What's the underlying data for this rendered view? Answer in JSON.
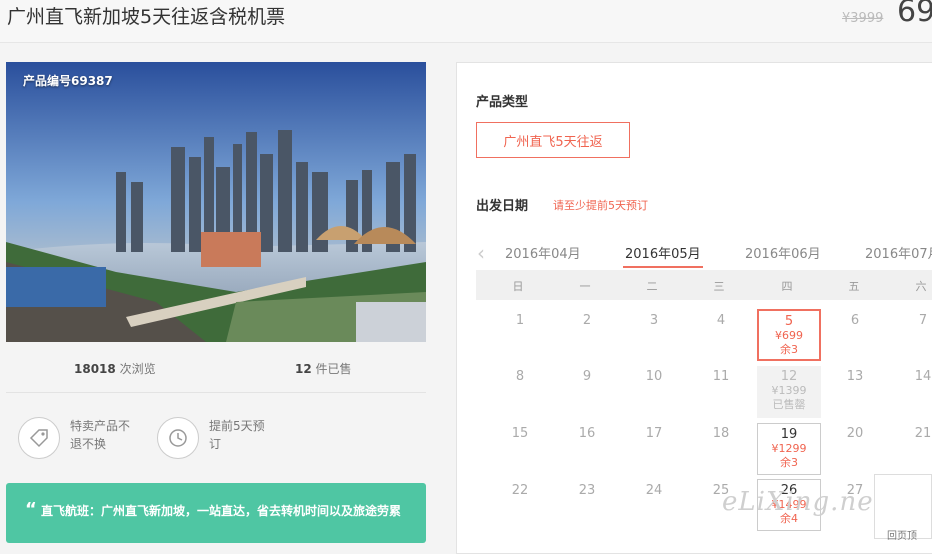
{
  "header": {
    "title": "广州直飞新加坡5天往返含税机票",
    "old_price": "¥3999",
    "price": "69"
  },
  "product": {
    "number_label": "产品编号69387",
    "views_count": "18018",
    "views_label": "次浏览",
    "sold_count": "12",
    "sold_label": "件已售"
  },
  "features": [
    {
      "icon": "tag-icon",
      "text": "特卖产品不退不换"
    },
    {
      "icon": "clock-icon",
      "text": "提前5天预订"
    }
  ],
  "banner": {
    "quote": "“",
    "text": "直飞航班：广州直飞新加坡，一站直达，省去转机时间以及旅途劳累"
  },
  "panel": {
    "type_label": "产品类型",
    "type_option": "广州直飞5天往返",
    "date_label": "出发日期",
    "date_hint": "请至少提前5天预订",
    "prev_arrow": "‹",
    "months": [
      "2016年04月",
      "2016年05月",
      "2016年06月",
      "2016年07月"
    ],
    "active_month": "2016年05月",
    "weekdays": [
      "日",
      "一",
      "二",
      "三",
      "四",
      "五",
      "六"
    ],
    "days": [
      "1",
      "2",
      "3",
      "4",
      "6",
      "7",
      "8",
      "9",
      "10",
      "11",
      "13",
      "14",
      "15",
      "16",
      "17",
      "18",
      "20",
      "21",
      "22",
      "23",
      "24",
      "25",
      "27"
    ],
    "special_days": [
      {
        "day": "5",
        "price": "¥699",
        "remain": "余3",
        "state": "selected"
      },
      {
        "day": "12",
        "price": "¥1399",
        "remain": "已售罄",
        "state": "sold-out"
      },
      {
        "day": "19",
        "price": "¥1299",
        "remain": "余3",
        "state": "available"
      },
      {
        "day": "26",
        "price": "¥1499",
        "remain": "余4",
        "state": "available"
      }
    ]
  },
  "watermark": "eLiXing.net",
  "back_top": "回页顶"
}
